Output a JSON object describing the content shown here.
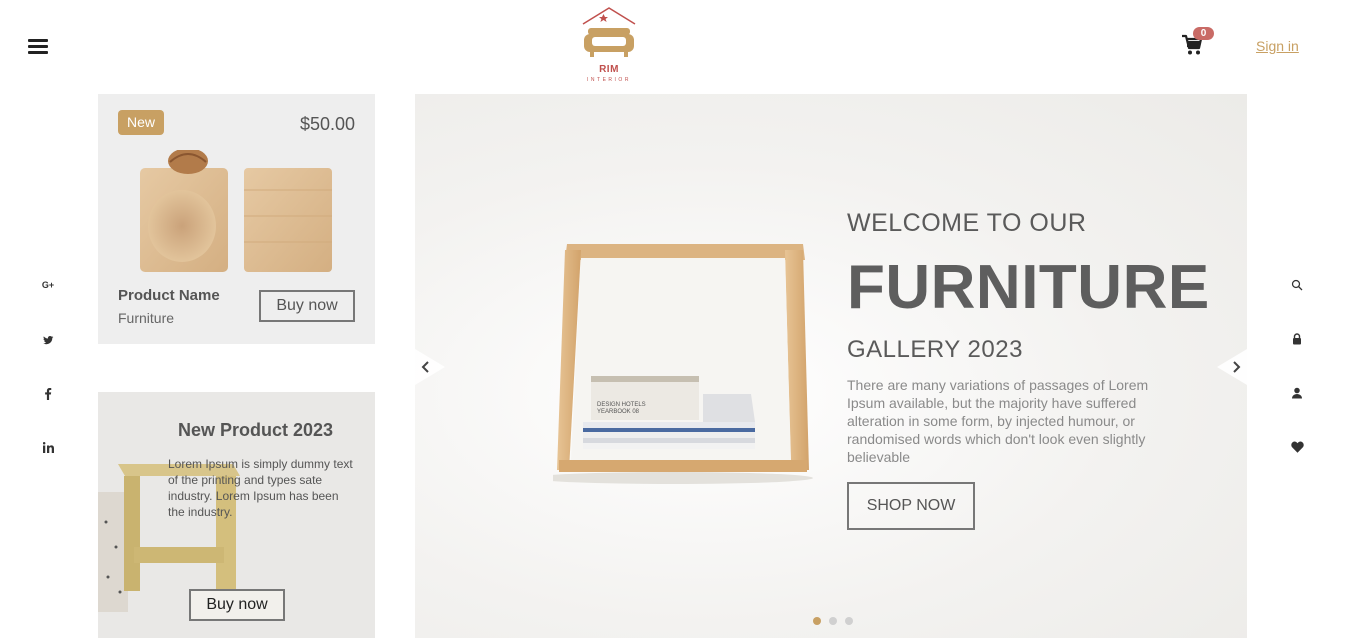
{
  "header": {
    "logo_text": "RIM",
    "logo_sub": "INTERIOR",
    "cart_count": "0",
    "signin_label": "Sign in"
  },
  "social": {
    "google_plus": "G+"
  },
  "card1": {
    "badge": "New",
    "price": "$50.00",
    "product_name": "Product Name",
    "category": "Furniture",
    "buy_label": "Buy now"
  },
  "card2": {
    "title": "New Product 2023",
    "text": "Lorem Ipsum is simply dummy text of the printing and types sate industry. Lorem Ipsum has been the industry.",
    "buy_label": "Buy now"
  },
  "hero": {
    "welcome": "WELCOME TO OUR",
    "headline": "FURNITURE",
    "subtitle": "GALLERY 2023",
    "description": "There are many variations of passages of Lorem Ipsum available, but the majority have suffered alteration in some form, by injected humour, or randomised words which don't look even slightly believable",
    "cta_label": "SHOP NOW",
    "slide_count": 3,
    "active_slide": 1
  },
  "colors": {
    "accent": "#c8a063",
    "badge_red": "#c96b66",
    "logo_red": "#c0504d"
  },
  "icons": {
    "left_social": [
      "google-plus-icon",
      "twitter-icon",
      "facebook-icon",
      "linkedin-icon"
    ],
    "right_tools": [
      "search-icon",
      "lock-icon",
      "user-icon",
      "heart-icon"
    ]
  }
}
